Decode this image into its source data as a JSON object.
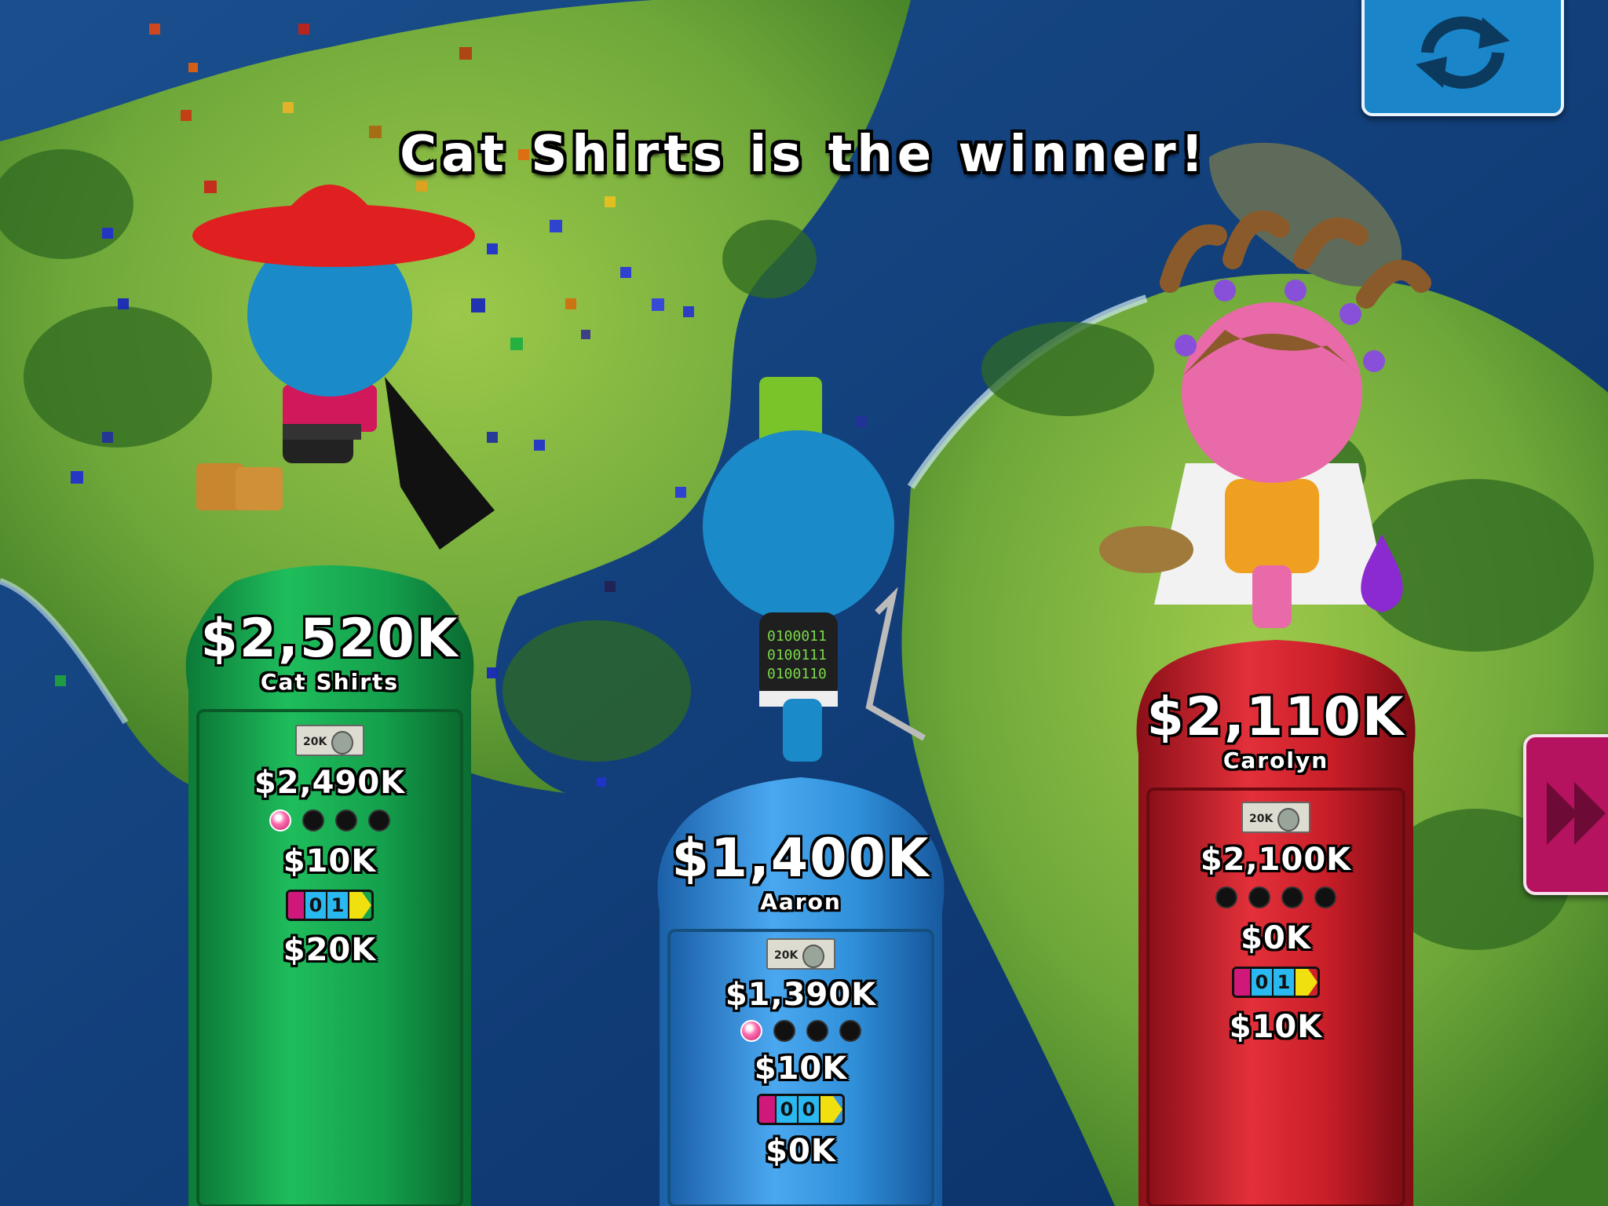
{
  "banner": "Cat Shirts is the winner!",
  "controls": {
    "refresh_icon": "refresh-icon",
    "next_icon": "fast-forward-icon"
  },
  "colors": {
    "ocean": "#0d3f7a",
    "land": "#6fa83a",
    "green_pedestal": "#14a04c",
    "blue_pedestal": "#2f8fd8",
    "red_pedestal": "#d0202c"
  },
  "players": [
    {
      "name": "Cat Shirts",
      "total": "$2,520K",
      "bill": "20K",
      "cash": "$2,490K",
      "pink_dots": 1,
      "dots": 4,
      "stat_a": "$10K",
      "spinner": "01",
      "stat_b": "$20K"
    },
    {
      "name": "Aaron",
      "total": "$1,400K",
      "bill": "20K",
      "cash": "$1,390K",
      "pink_dots": 1,
      "dots": 4,
      "stat_a": "$10K",
      "spinner": "00",
      "stat_b": "$0K",
      "shirt_text": [
        "0100011",
        "0100111",
        "0100110"
      ]
    },
    {
      "name": "Carolyn",
      "total": "$2,110K",
      "bill": "20K",
      "cash": "$2,100K",
      "pink_dots": 0,
      "dots": 4,
      "stat_a": "$0K",
      "spinner": "01",
      "stat_b": "$10K"
    }
  ]
}
